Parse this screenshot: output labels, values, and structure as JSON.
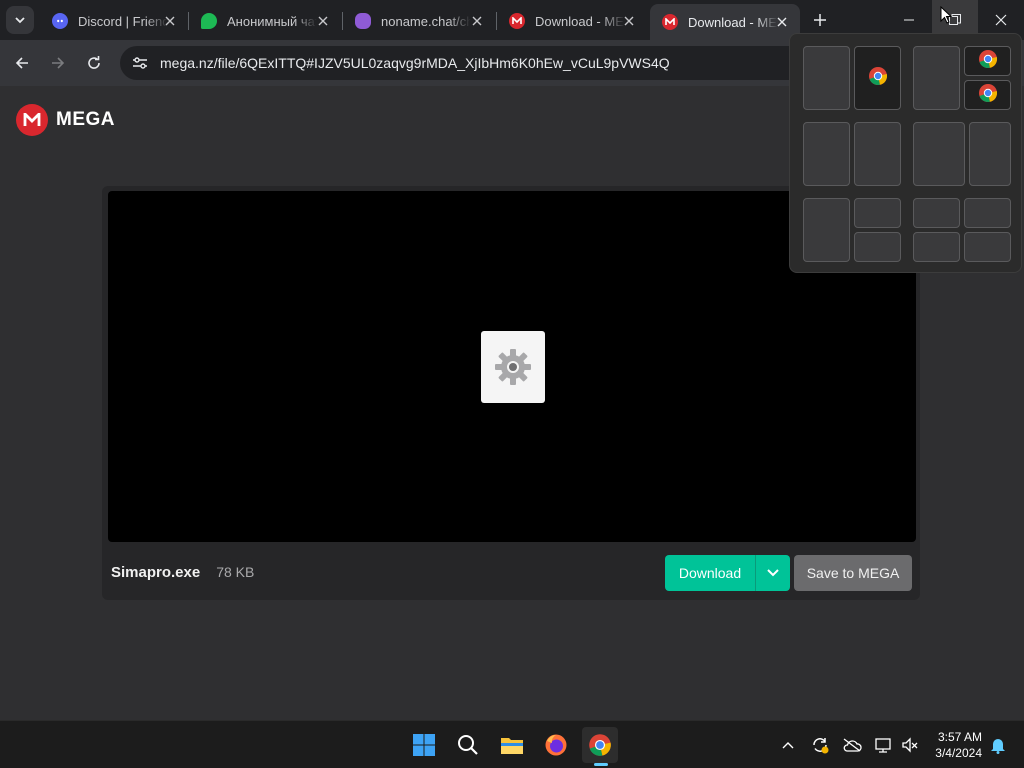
{
  "browser": {
    "tabs": [
      {
        "title": "Discord | Friends",
        "favicon": "discord-icon",
        "color": "#5865f2"
      },
      {
        "title": "Анонимный чат",
        "favicon": "chat-bubble-icon",
        "color": "#1db954"
      },
      {
        "title": "noname.chat/chat",
        "favicon": "chat-hearts-icon",
        "color": "#8f5bd6"
      },
      {
        "title": "Download - MEGA",
        "favicon": "mega-icon",
        "color": "#d9272e"
      },
      {
        "title": "Download - MEGA",
        "favicon": "mega-icon",
        "color": "#d9272e",
        "active": true
      }
    ],
    "url": "mega.nz/file/6QExITTQ#IJZV5UL0zaqvg9rMDA_XjIbHm6K0hEw_vCuL9pVWS4Q"
  },
  "page": {
    "brand": "MEGA",
    "brand_color": "#d9272e",
    "file": {
      "name": "Simapro.exe",
      "size": "78 KB",
      "icon": "gear-file-icon"
    },
    "buttons": {
      "download": "Download",
      "save": "Save to MEGA"
    },
    "accent_color": "#00c398"
  },
  "snap_layouts": {
    "icon_in_zone": "chrome-icon"
  },
  "taskbar": {
    "apps": [
      "windows-start-icon",
      "search-icon",
      "file-explorer-icon",
      "firefox-icon",
      "chrome-icon"
    ],
    "time": "3:57 AM",
    "date": "3/4/2024"
  }
}
